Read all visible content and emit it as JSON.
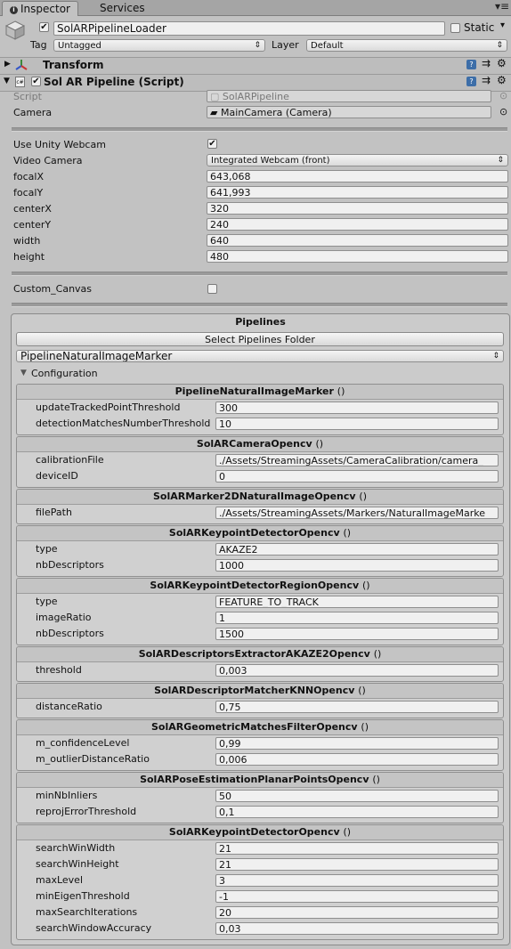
{
  "tabs": [
    {
      "label": "Inspector",
      "icon": "info-icon",
      "active": true
    },
    {
      "label": "Services",
      "active": false
    }
  ],
  "menu_icon": "lock-menu-icon",
  "object": {
    "name": "SolARPipelineLoader",
    "static_label": "Static",
    "tag_label": "Tag",
    "tag_value": "Untagged",
    "layer_label": "Layer",
    "layer_value": "Default"
  },
  "components": {
    "transform_label": "Transform",
    "script_component_label": "Sol AR Pipeline (Script)"
  },
  "script_fields": {
    "script_label": "Script",
    "script_value": "SolARPipeline",
    "camera_label": "Camera",
    "camera_value": "MainCamera (Camera)"
  },
  "settings": {
    "use_webcam_label": "Use Unity Webcam",
    "video_camera_label": "Video Camera",
    "video_camera_value": "Integrated Webcam (front)",
    "fields": [
      {
        "label": "focalX",
        "value": "643,068"
      },
      {
        "label": "focalY",
        "value": "641,993"
      },
      {
        "label": "centerX",
        "value": "320"
      },
      {
        "label": "centerY",
        "value": "240"
      },
      {
        "label": "width",
        "value": "640"
      },
      {
        "label": "height",
        "value": "480"
      }
    ],
    "custom_canvas_label": "Custom_Canvas"
  },
  "pipelines": {
    "title": "Pipelines",
    "select_button": "Select Pipelines Folder",
    "selected_pipeline": "PipelineNaturalImageMarker",
    "configuration_label": "Configuration",
    "modules": [
      {
        "name": "PipelineNaturalImageMarker",
        "paren": "()",
        "params": [
          {
            "label": "updateTrackedPointThreshold",
            "value": "300"
          },
          {
            "label": "detectionMatchesNumberThreshold",
            "value": "10"
          }
        ]
      },
      {
        "name": "SolARCameraOpencv",
        "paren": "()",
        "params": [
          {
            "label": "calibrationFile",
            "value": "./Assets/StreamingAssets/CameraCalibration/camera_"
          },
          {
            "label": "deviceID",
            "value": "0"
          }
        ]
      },
      {
        "name": "SolARMarker2DNaturalImageOpencv",
        "paren": "()",
        "params": [
          {
            "label": "filePath",
            "value": "./Assets/StreamingAssets/Markers/NaturalImageMarke"
          }
        ]
      },
      {
        "name": "SolARKeypointDetectorOpencv",
        "paren": "()",
        "params": [
          {
            "label": "type",
            "value": "AKAZE2"
          },
          {
            "label": "nbDescriptors",
            "value": "1000"
          }
        ]
      },
      {
        "name": "SolARKeypointDetectorRegionOpencv",
        "paren": "()",
        "params": [
          {
            "label": "type",
            "value": "FEATURE_TO_TRACK"
          },
          {
            "label": "imageRatio",
            "value": "1"
          },
          {
            "label": "nbDescriptors",
            "value": "1500"
          }
        ]
      },
      {
        "name": "SolARDescriptorsExtractorAKAZE2Opencv",
        "paren": "()",
        "params": [
          {
            "label": "threshold",
            "value": "0,003"
          }
        ]
      },
      {
        "name": "SolARDescriptorMatcherKNNOpencv",
        "paren": "()",
        "params": [
          {
            "label": "distanceRatio",
            "value": "0,75"
          }
        ]
      },
      {
        "name": "SolARGeometricMatchesFilterOpencv",
        "paren": "()",
        "params": [
          {
            "label": "m_confidenceLevel",
            "value": "0,99"
          },
          {
            "label": "m_outlierDistanceRatio",
            "value": "0,006"
          }
        ]
      },
      {
        "name": "SolARPoseEstimationPlanarPointsOpencv",
        "paren": "()",
        "params": [
          {
            "label": "minNbInliers",
            "value": "50"
          },
          {
            "label": "reprojErrorThreshold",
            "value": "0,1"
          }
        ]
      },
      {
        "name": "SolARKeypointDetectorOpencv",
        "paren": "()",
        "params": [
          {
            "label": "searchWinWidth",
            "value": "21"
          },
          {
            "label": "searchWinHeight",
            "value": "21"
          },
          {
            "label": "maxLevel",
            "value": "3"
          },
          {
            "label": "minEigenThreshold",
            "value": "-1"
          },
          {
            "label": "maxSearchIterations",
            "value": "20"
          },
          {
            "label": "searchWindowAccuracy",
            "value": "0,03"
          }
        ]
      }
    ]
  }
}
